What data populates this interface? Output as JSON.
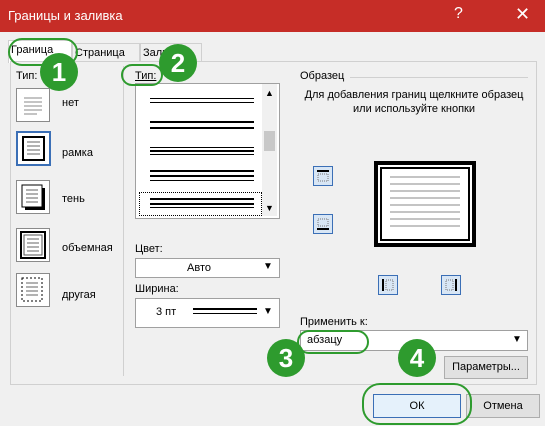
{
  "window": {
    "title": "Границы и заливка",
    "help_icon": "?",
    "close_icon": "✕"
  },
  "tabs": [
    {
      "label": "Граница"
    },
    {
      "label": "Страница"
    },
    {
      "label": "Заливка"
    }
  ],
  "left": {
    "section_label": "Тип:",
    "types": [
      {
        "label": "нет"
      },
      {
        "label": "рамка"
      },
      {
        "label": "тень"
      },
      {
        "label": "объемная"
      },
      {
        "label": "другая"
      }
    ]
  },
  "middle": {
    "type_label": "Тип:",
    "color_label": "Цвет:",
    "color_value": "Авто",
    "width_label": "Ширина:",
    "width_value": "3 пт"
  },
  "right": {
    "sample_label": "Образец",
    "instruction": "Для добавления границ щелкните образец или используйте кнопки",
    "apply_label": "Применить к:",
    "apply_value": "абзацу",
    "params_button": "Параметры..."
  },
  "buttons": {
    "ok": "ОК",
    "cancel": "Отмена"
  },
  "callouts": [
    "1",
    "2",
    "3",
    "4"
  ]
}
